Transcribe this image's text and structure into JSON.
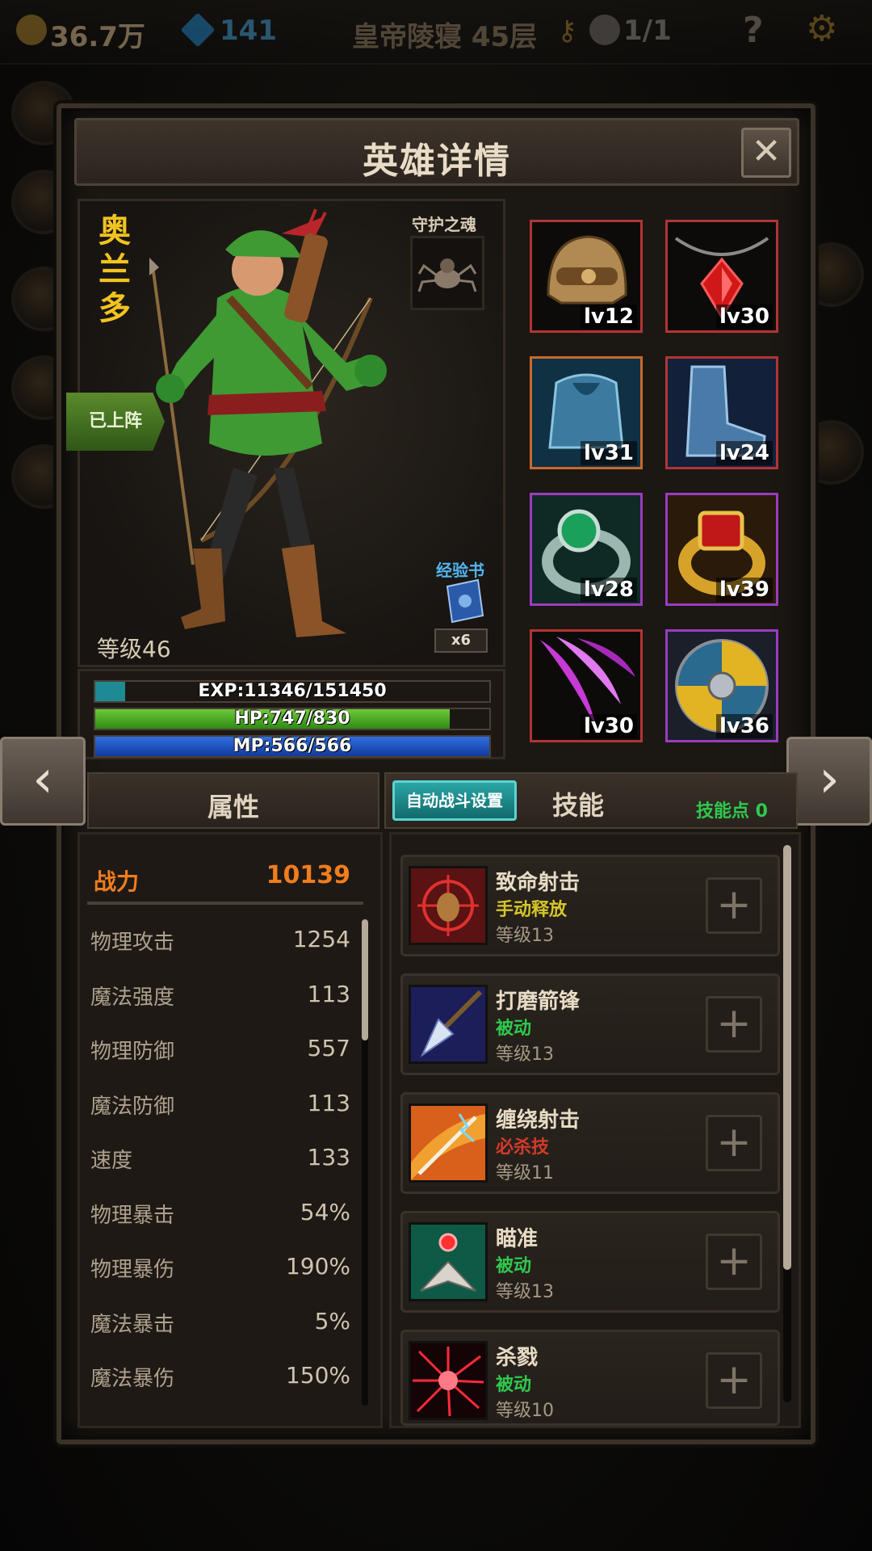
{
  "top_bar": {
    "gold": "36.7万",
    "gems": "141",
    "location": "皇帝陵寝 45层",
    "skull_count": "1/1",
    "help": "?"
  },
  "panel": {
    "title": "英雄详情",
    "close": "✕"
  },
  "hero": {
    "name": "奥兰多",
    "deployed_label": "已上阵",
    "soul_label": "守护之魂",
    "exp_book_label": "经验书",
    "exp_book_count": "x6",
    "level_text": "等级46",
    "exp_text": "EXP:11346/151450",
    "exp_fraction": 0.075,
    "hp_text": "HP:747/830",
    "hp_fraction": 0.9,
    "mp_text": "MP:566/566",
    "mp_fraction": 1.0
  },
  "equipment": [
    {
      "slot": "helmet",
      "level": "lv12",
      "border": "#b23434"
    },
    {
      "slot": "amulet",
      "level": "lv30",
      "border": "#b23434"
    },
    {
      "slot": "armor",
      "level": "lv31",
      "border": "#c86a2a"
    },
    {
      "slot": "boots",
      "level": "lv24",
      "border": "#b23434"
    },
    {
      "slot": "ring",
      "level": "lv28",
      "border": "#9a3cc0"
    },
    {
      "slot": "ring2",
      "level": "lv39",
      "border": "#9a3cc0"
    },
    {
      "slot": "claw",
      "level": "lv30",
      "border": "#b23434"
    },
    {
      "slot": "shield",
      "level": "lv36",
      "border": "#9a3cc0"
    }
  ],
  "nav": {
    "prev": "‹",
    "next": "›"
  },
  "stats": {
    "title": "属性",
    "power_label": "战力",
    "power_value": "10139",
    "rows": [
      {
        "name": "物理攻击",
        "value": "1254"
      },
      {
        "name": "魔法强度",
        "value": "113"
      },
      {
        "name": "物理防御",
        "value": "557"
      },
      {
        "name": "魔法防御",
        "value": "113"
      },
      {
        "name": "速度",
        "value": "133"
      },
      {
        "name": "物理暴击",
        "value": "54%"
      },
      {
        "name": "物理暴伤",
        "value": "190%"
      },
      {
        "name": "魔法暴击",
        "value": "5%"
      },
      {
        "name": "魔法暴伤",
        "value": "150%"
      }
    ]
  },
  "skills": {
    "auto_battle_label": "自动战斗设置",
    "title": "技能",
    "points_label": "技能点 0",
    "plus": "+",
    "items": [
      {
        "name": "致命射击",
        "type": "手动释放",
        "type_color": "#d6c62a",
        "level": "等级13",
        "icon": "crosshair-icon"
      },
      {
        "name": "打磨箭锋",
        "type": "被动",
        "type_color": "#2ec94e",
        "level": "等级13",
        "icon": "arrowhead-icon"
      },
      {
        "name": "缠绕射击",
        "type": "必杀技",
        "type_color": "#d23a2a",
        "level": "等级11",
        "icon": "lightning-arrow-icon"
      },
      {
        "name": "瞄准",
        "type": "被动",
        "type_color": "#2ec94e",
        "level": "等级13",
        "icon": "aim-icon"
      },
      {
        "name": "杀戮",
        "type": "被动",
        "type_color": "#2ec94e",
        "level": "等级10",
        "icon": "burst-icon"
      }
    ]
  }
}
